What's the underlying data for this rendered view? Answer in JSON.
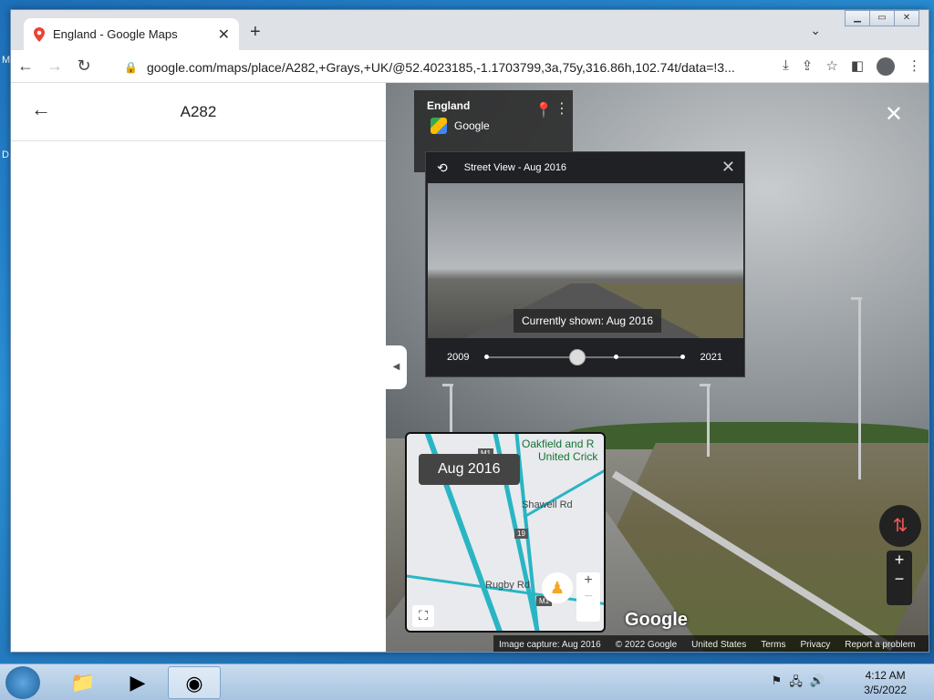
{
  "browser": {
    "tab_title": "England - Google Maps",
    "url": "google.com/maps/place/A282,+Grays,+UK/@52.4023185,-1.1703799,3a,75y,316.86h,102.74t/data=!3..."
  },
  "left_panel": {
    "title": "A282"
  },
  "infocard": {
    "place": "England",
    "source": "Google"
  },
  "timeline": {
    "header": "Street View - Aug 2016",
    "caption": "Currently shown: Aug 2016",
    "start_year": "2009",
    "end_year": "2021"
  },
  "minimap": {
    "date": "Aug 2016",
    "label_oakfield": "Oakfield and R",
    "label_cricket": "United Crick",
    "road_shawell": "Shawell Rd",
    "road_rugby": "Rugby Rd",
    "shield_m1": "M1",
    "shield_19": "19",
    "shield_m1b": "M1"
  },
  "footer": {
    "capture": "Image capture: Aug 2016",
    "copyright": "© 2022 Google",
    "country": "United States",
    "terms": "Terms",
    "privacy": "Privacy",
    "report": "Report a problem"
  },
  "streetview": {
    "logo": "Google"
  },
  "taskbar": {
    "time": "4:12 AM",
    "date": "3/5/2022"
  },
  "icons": [
    "maps-favicon",
    "close-icon",
    "plus-icon",
    "back-icon",
    "forward-icon",
    "reload-icon",
    "lock-icon",
    "install-icon",
    "share-icon",
    "star-icon",
    "sidebar-icon",
    "profile-icon",
    "kebab-icon",
    "pin-icon",
    "history-icon",
    "compass-icon",
    "pegman-icon",
    "fullscreen-icon"
  ]
}
